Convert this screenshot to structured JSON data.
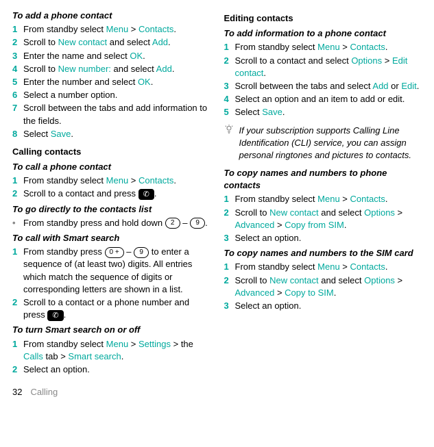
{
  "left": {
    "h1": "To add a phone contact",
    "s1": {
      "pre": "From standby select ",
      "menu": "Menu",
      "gt": " > ",
      "contacts": "Contacts",
      "post": "."
    },
    "s2": {
      "pre": "Scroll to ",
      "newcontact": "New contact",
      "mid": " and select ",
      "add": "Add",
      "post": "."
    },
    "s3": {
      "pre": "Enter the name and select ",
      "ok": "OK",
      "post": "."
    },
    "s4": {
      "pre": "Scroll to ",
      "newnum": "New number:",
      "mid": " and select ",
      "add": "Add",
      "post": "."
    },
    "s5": {
      "pre": "Enter the number and select ",
      "ok": "OK",
      "post": "."
    },
    "s6": "Select a number option.",
    "s7": "Scroll between the tabs and add information to the fields.",
    "s8": {
      "pre": "Select ",
      "save": "Save",
      "post": "."
    },
    "h2": "Calling contacts",
    "h3": "To call a phone contact",
    "c1": {
      "pre": "From standby select ",
      "menu": "Menu",
      "gt": " > ",
      "contacts": "Contacts",
      "post": "."
    },
    "c2": {
      "pre": "Scroll to a contact and press ",
      "post": "."
    },
    "h4": "To go directly to the contacts list",
    "d1": {
      "pre": "From standby press and hold down ",
      "k1": "2",
      "dash": " – ",
      "k2": "9",
      "post": "."
    },
    "h5": "To call with Smart search",
    "sm1": {
      "pre": "From standby press ",
      "k1": "0 +",
      "dash": " – ",
      "k2": "9",
      "mid": " to enter a sequence of (at least two) digits. All entries which match the sequence of digits or corresponding letters are shown in a list."
    },
    "sm2": {
      "pre": "Scroll to a contact or a phone number and press ",
      "post": "."
    },
    "h6": "To turn Smart search on or off",
    "t1": {
      "pre": "From standby select ",
      "menu": "Menu",
      "gt1": " > ",
      "settings": "Settings",
      "gt2": " > the ",
      "calls": "Calls",
      "tab": " tab > ",
      "smart": "Smart search",
      "post": "."
    },
    "t2": "Select an option."
  },
  "right": {
    "h1": "Editing contacts",
    "h2": "To add information to a phone contact",
    "e1": {
      "pre": "From standby select ",
      "menu": "Menu",
      "gt": " > ",
      "contacts": "Contacts",
      "post": "."
    },
    "e2": {
      "pre": "Scroll to a contact and select ",
      "options": "Options",
      "gt": " > ",
      "edit": "Edit contact",
      "post": "."
    },
    "e3": {
      "pre": "Scroll between the tabs and select ",
      "add": "Add",
      "or": " or ",
      "edit": "Edit",
      "post": "."
    },
    "e4": "Select an option and an item to add or edit.",
    "e5": {
      "pre": "Select ",
      "save": "Save",
      "post": "."
    },
    "tip": "If your subscription supports Calling Line Identification (CLI) service, you can assign personal ringtones and pictures to contacts.",
    "h3": "To copy names and numbers to phone contacts",
    "p1": {
      "pre": "From standby select ",
      "menu": "Menu",
      "gt": " > ",
      "contacts": "Contacts",
      "post": "."
    },
    "p2": {
      "pre": "Scroll to ",
      "newcontact": "New contact",
      "mid": " and select ",
      "options": "Options",
      "gt1": " > ",
      "advanced": "Advanced",
      "gt2": " > ",
      "copy": "Copy from SIM",
      "post": "."
    },
    "p3": "Select an option.",
    "h4": "To copy names and numbers to the SIM card",
    "q1": {
      "pre": "From standby select ",
      "menu": "Menu",
      "gt": " > ",
      "contacts": "Contacts",
      "post": "."
    },
    "q2": {
      "pre": "Scroll to ",
      "newcontact": "New contact",
      "mid": " and select ",
      "options": "Options",
      "gt1": " > ",
      "advanced": "Advanced",
      "gt2": " > ",
      "copy": "Copy to SIM",
      "post": "."
    },
    "q3": "Select an option."
  },
  "footer": {
    "page": "32",
    "section": "Calling"
  },
  "call_icon": "✆"
}
